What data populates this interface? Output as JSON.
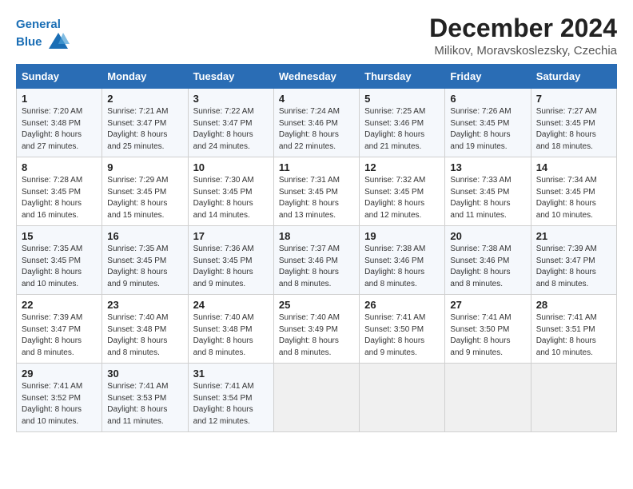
{
  "logo": {
    "line1": "General",
    "line2": "Blue",
    "icon_color": "#1a6eb5"
  },
  "title": "December 2024",
  "subtitle": "Milikov, Moravskoslezsky, Czechia",
  "weekdays": [
    "Sunday",
    "Monday",
    "Tuesday",
    "Wednesday",
    "Thursday",
    "Friday",
    "Saturday"
  ],
  "weeks": [
    [
      {
        "day": "1",
        "sunrise": "Sunrise: 7:20 AM",
        "sunset": "Sunset: 3:48 PM",
        "daylight": "Daylight: 8 hours and 27 minutes."
      },
      {
        "day": "2",
        "sunrise": "Sunrise: 7:21 AM",
        "sunset": "Sunset: 3:47 PM",
        "daylight": "Daylight: 8 hours and 25 minutes."
      },
      {
        "day": "3",
        "sunrise": "Sunrise: 7:22 AM",
        "sunset": "Sunset: 3:47 PM",
        "daylight": "Daylight: 8 hours and 24 minutes."
      },
      {
        "day": "4",
        "sunrise": "Sunrise: 7:24 AM",
        "sunset": "Sunset: 3:46 PM",
        "daylight": "Daylight: 8 hours and 22 minutes."
      },
      {
        "day": "5",
        "sunrise": "Sunrise: 7:25 AM",
        "sunset": "Sunset: 3:46 PM",
        "daylight": "Daylight: 8 hours and 21 minutes."
      },
      {
        "day": "6",
        "sunrise": "Sunrise: 7:26 AM",
        "sunset": "Sunset: 3:45 PM",
        "daylight": "Daylight: 8 hours and 19 minutes."
      },
      {
        "day": "7",
        "sunrise": "Sunrise: 7:27 AM",
        "sunset": "Sunset: 3:45 PM",
        "daylight": "Daylight: 8 hours and 18 minutes."
      }
    ],
    [
      {
        "day": "8",
        "sunrise": "Sunrise: 7:28 AM",
        "sunset": "Sunset: 3:45 PM",
        "daylight": "Daylight: 8 hours and 16 minutes."
      },
      {
        "day": "9",
        "sunrise": "Sunrise: 7:29 AM",
        "sunset": "Sunset: 3:45 PM",
        "daylight": "Daylight: 8 hours and 15 minutes."
      },
      {
        "day": "10",
        "sunrise": "Sunrise: 7:30 AM",
        "sunset": "Sunset: 3:45 PM",
        "daylight": "Daylight: 8 hours and 14 minutes."
      },
      {
        "day": "11",
        "sunrise": "Sunrise: 7:31 AM",
        "sunset": "Sunset: 3:45 PM",
        "daylight": "Daylight: 8 hours and 13 minutes."
      },
      {
        "day": "12",
        "sunrise": "Sunrise: 7:32 AM",
        "sunset": "Sunset: 3:45 PM",
        "daylight": "Daylight: 8 hours and 12 minutes."
      },
      {
        "day": "13",
        "sunrise": "Sunrise: 7:33 AM",
        "sunset": "Sunset: 3:45 PM",
        "daylight": "Daylight: 8 hours and 11 minutes."
      },
      {
        "day": "14",
        "sunrise": "Sunrise: 7:34 AM",
        "sunset": "Sunset: 3:45 PM",
        "daylight": "Daylight: 8 hours and 10 minutes."
      }
    ],
    [
      {
        "day": "15",
        "sunrise": "Sunrise: 7:35 AM",
        "sunset": "Sunset: 3:45 PM",
        "daylight": "Daylight: 8 hours and 10 minutes."
      },
      {
        "day": "16",
        "sunrise": "Sunrise: 7:35 AM",
        "sunset": "Sunset: 3:45 PM",
        "daylight": "Daylight: 8 hours and 9 minutes."
      },
      {
        "day": "17",
        "sunrise": "Sunrise: 7:36 AM",
        "sunset": "Sunset: 3:45 PM",
        "daylight": "Daylight: 8 hours and 9 minutes."
      },
      {
        "day": "18",
        "sunrise": "Sunrise: 7:37 AM",
        "sunset": "Sunset: 3:46 PM",
        "daylight": "Daylight: 8 hours and 8 minutes."
      },
      {
        "day": "19",
        "sunrise": "Sunrise: 7:38 AM",
        "sunset": "Sunset: 3:46 PM",
        "daylight": "Daylight: 8 hours and 8 minutes."
      },
      {
        "day": "20",
        "sunrise": "Sunrise: 7:38 AM",
        "sunset": "Sunset: 3:46 PM",
        "daylight": "Daylight: 8 hours and 8 minutes."
      },
      {
        "day": "21",
        "sunrise": "Sunrise: 7:39 AM",
        "sunset": "Sunset: 3:47 PM",
        "daylight": "Daylight: 8 hours and 8 minutes."
      }
    ],
    [
      {
        "day": "22",
        "sunrise": "Sunrise: 7:39 AM",
        "sunset": "Sunset: 3:47 PM",
        "daylight": "Daylight: 8 hours and 8 minutes."
      },
      {
        "day": "23",
        "sunrise": "Sunrise: 7:40 AM",
        "sunset": "Sunset: 3:48 PM",
        "daylight": "Daylight: 8 hours and 8 minutes."
      },
      {
        "day": "24",
        "sunrise": "Sunrise: 7:40 AM",
        "sunset": "Sunset: 3:48 PM",
        "daylight": "Daylight: 8 hours and 8 minutes."
      },
      {
        "day": "25",
        "sunrise": "Sunrise: 7:40 AM",
        "sunset": "Sunset: 3:49 PM",
        "daylight": "Daylight: 8 hours and 8 minutes."
      },
      {
        "day": "26",
        "sunrise": "Sunrise: 7:41 AM",
        "sunset": "Sunset: 3:50 PM",
        "daylight": "Daylight: 8 hours and 9 minutes."
      },
      {
        "day": "27",
        "sunrise": "Sunrise: 7:41 AM",
        "sunset": "Sunset: 3:50 PM",
        "daylight": "Daylight: 8 hours and 9 minutes."
      },
      {
        "day": "28",
        "sunrise": "Sunrise: 7:41 AM",
        "sunset": "Sunset: 3:51 PM",
        "daylight": "Daylight: 8 hours and 10 minutes."
      }
    ],
    [
      {
        "day": "29",
        "sunrise": "Sunrise: 7:41 AM",
        "sunset": "Sunset: 3:52 PM",
        "daylight": "Daylight: 8 hours and 10 minutes."
      },
      {
        "day": "30",
        "sunrise": "Sunrise: 7:41 AM",
        "sunset": "Sunset: 3:53 PM",
        "daylight": "Daylight: 8 hours and 11 minutes."
      },
      {
        "day": "31",
        "sunrise": "Sunrise: 7:41 AM",
        "sunset": "Sunset: 3:54 PM",
        "daylight": "Daylight: 8 hours and 12 minutes."
      },
      null,
      null,
      null,
      null
    ]
  ]
}
